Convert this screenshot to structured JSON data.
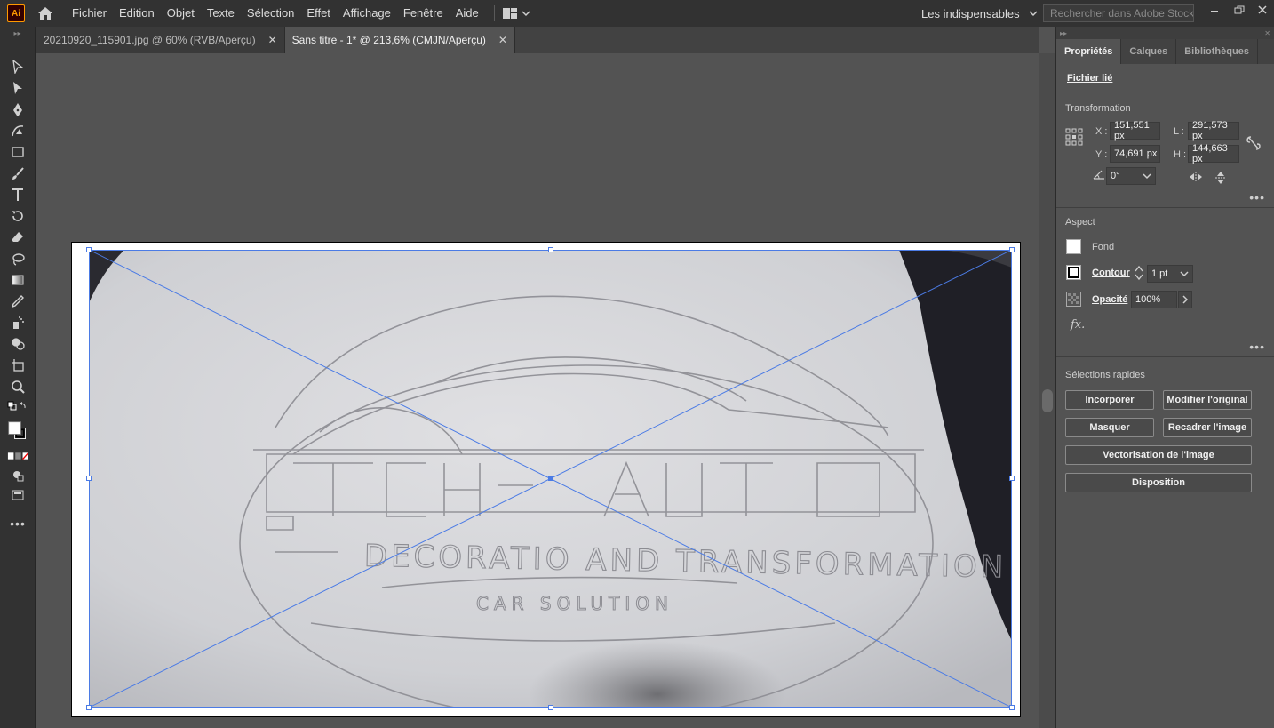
{
  "app": {
    "logo_text": "Ai"
  },
  "menu": [
    "Fichier",
    "Edition",
    "Objet",
    "Texte",
    "Sélection",
    "Effet",
    "Affichage",
    "Fenêtre",
    "Aide"
  ],
  "workspace_label": "Les indispensables",
  "search": {
    "placeholder": "Rechercher dans Adobe Stock"
  },
  "tabs": [
    {
      "label": "20210920_115901.jpg @ 60% (RVB/Aperçu)",
      "active": false
    },
    {
      "label": "Sans titre - 1* @ 213,6% (CMJN/Aperçu)",
      "active": true
    }
  ],
  "panel": {
    "tabs": [
      "Propriétés",
      "Calques",
      "Bibliothèques"
    ],
    "linked_file_label": "Fichier lié",
    "transform": {
      "title": "Transformation",
      "x_label": "X :",
      "x_value": "151,551 px",
      "y_label": "Y :",
      "y_value": "74,691 px",
      "w_label": "L :",
      "w_value": "291,573 px",
      "h_label": "H :",
      "h_value": "144,663 px",
      "rotation_value": "0°"
    },
    "appearance": {
      "title": "Aspect",
      "fill_label": "Fond",
      "stroke_label": "Contour",
      "stroke_value": "1 pt",
      "opacity_label": "Opacité",
      "opacity_value": "100%",
      "fx_label": "fx."
    },
    "quick_actions": {
      "title": "Sélections rapides",
      "embed": "Incorporer",
      "edit_original": "Modifier l'original",
      "mask": "Masquer",
      "crop": "Recadrer l'image",
      "trace": "Vectorisation de l'image",
      "arrange": "Disposition"
    }
  },
  "colors": {
    "accent": "#4b7be5",
    "ui_dark": "#323232",
    "ui_mid": "#535353"
  },
  "image": {
    "logo_text": "TCH-AUTO",
    "tagline": "DECORATIO AND TRANSFORMATION",
    "sub": "CAR SOLUTION"
  }
}
